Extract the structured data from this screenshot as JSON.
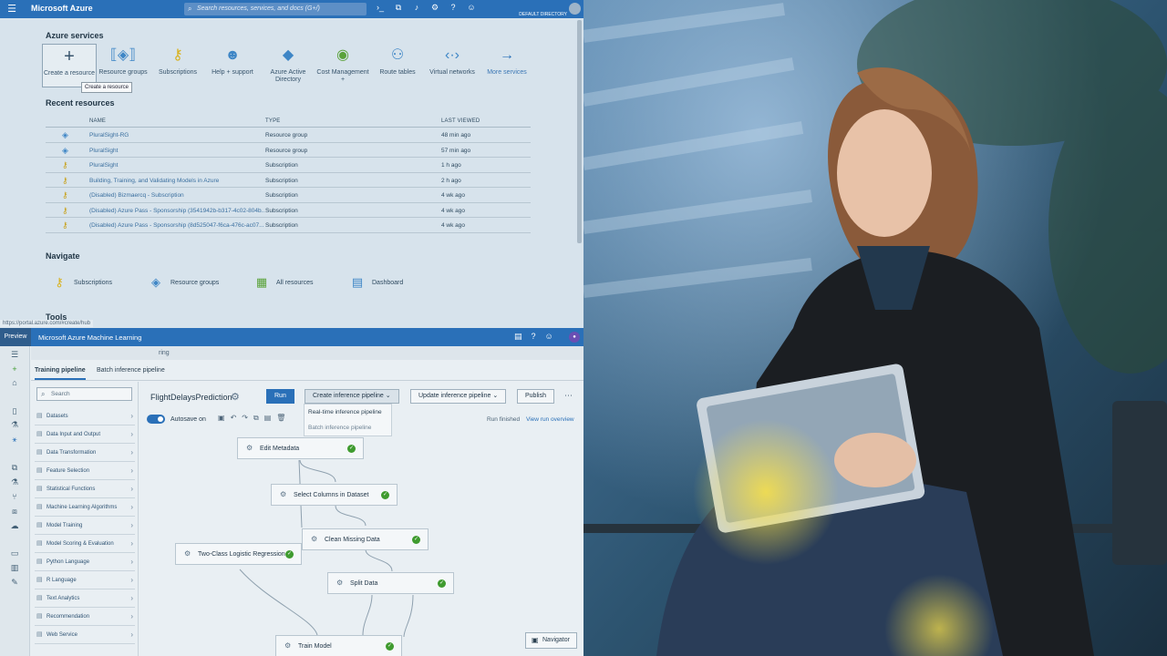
{
  "portal": {
    "brand": "Microsoft Azure",
    "search_placeholder": "Search resources, services, and docs (G+/)",
    "directory": "DEFAULT DIRECTORY",
    "services_heading": "Azure services",
    "services": [
      {
        "label": "Create a resource",
        "icon": "plus-icon"
      },
      {
        "label": "Resource groups",
        "icon": "resource-group-icon"
      },
      {
        "label": "Subscriptions",
        "icon": "key-icon"
      },
      {
        "label": "Help + support",
        "icon": "support-icon"
      },
      {
        "label": "Azure Active Directory",
        "icon": "aad-icon"
      },
      {
        "label": "Cost Management +",
        "icon": "cost-icon"
      },
      {
        "label": "Route tables",
        "icon": "route-icon"
      },
      {
        "label": "Virtual networks",
        "icon": "vnet-icon"
      },
      {
        "label": "More services",
        "icon": "arrow-right-icon"
      }
    ],
    "tooltip": "Create a resource",
    "recent_heading": "Recent resources",
    "recent_columns": [
      "NAME",
      "TYPE",
      "LAST VIEWED"
    ],
    "recent_rows": [
      {
        "name": "PluralSight-RG",
        "type": "Resource group",
        "viewed": "48 min ago",
        "icon": "resource-group-icon"
      },
      {
        "name": "PluralSight",
        "type": "Resource group",
        "viewed": "57 min ago",
        "icon": "resource-group-icon"
      },
      {
        "name": "PluralSight",
        "type": "Subscription",
        "viewed": "1 h ago",
        "icon": "key-icon"
      },
      {
        "name": "Building, Training, and Validating Models in Azure",
        "type": "Subscription",
        "viewed": "2 h ago",
        "icon": "key-icon"
      },
      {
        "name": "(Disabled) Bizmaercq - Subscription",
        "type": "Subscription",
        "viewed": "4 wk ago",
        "icon": "key-icon"
      },
      {
        "name": "(Disabled) Azure Pass - Sponsorship (3541942b-b317-4c02-804b...",
        "type": "Subscription",
        "viewed": "4 wk ago",
        "icon": "key-icon"
      },
      {
        "name": "(Disabled) Azure Pass - Sponsorship (8d525047-f6ca-476c-ac07...",
        "type": "Subscription",
        "viewed": "4 wk ago",
        "icon": "key-icon"
      }
    ],
    "navigate_heading": "Navigate",
    "navigate_items": [
      "Subscriptions",
      "Resource groups",
      "All resources",
      "Dashboard"
    ],
    "tools_heading": "Tools",
    "status_url": "https://portal.azure.com/#create/hub"
  },
  "designer": {
    "preview_label": "Preview",
    "title": "Microsoft Azure Machine Learning",
    "breadcrumb": "ring",
    "tabs": [
      "Training pipeline",
      "Batch inference pipeline"
    ],
    "search_placeholder": "Search",
    "categories": [
      "Datasets",
      "Data Input and Output",
      "Data Transformation",
      "Feature Selection",
      "Statistical Functions",
      "Machine Learning Algorithms",
      "Model Training",
      "Model Scoring & Evaluation",
      "Python Language",
      "R Language",
      "Text Analytics",
      "Recommendation",
      "Web Service"
    ],
    "pipeline_title": "FlightDelaysPrediction",
    "buttons": {
      "run": "Run",
      "create_inference": "Create inference pipeline",
      "update_inference": "Update inference pipeline",
      "publish": "Publish"
    },
    "menu_items": [
      "Real-time inference pipeline",
      "Batch inference pipeline"
    ],
    "autosave_label": "Autosave on",
    "run_status": "Run finished",
    "run_link": "View run overview",
    "nodes": [
      "Edit Metadata",
      "Select Columns in Dataset",
      "Clean Missing Data",
      "Two-Class Logistic Regression",
      "Split Data",
      "Train Model"
    ],
    "navigator": "Navigator"
  }
}
